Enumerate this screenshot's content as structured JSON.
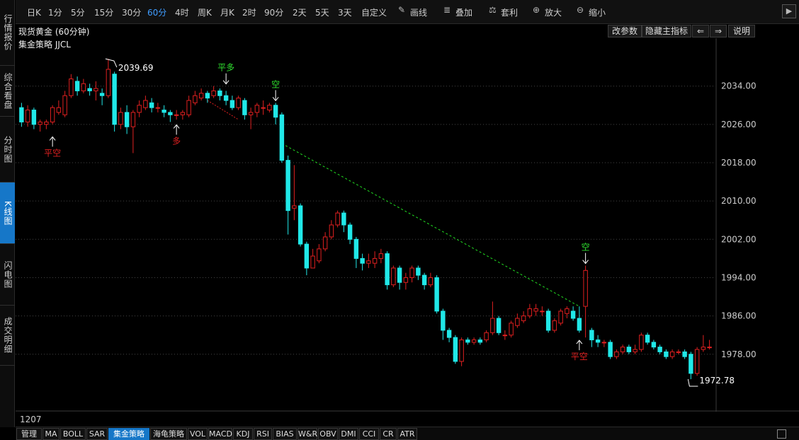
{
  "sidebar": {
    "tabs": [
      {
        "label": "行情报价",
        "active": false
      },
      {
        "label": "综合看盘",
        "active": false
      },
      {
        "label": "分时图",
        "active": false
      },
      {
        "label": "K线图",
        "active": true
      },
      {
        "label": "闪电图",
        "active": false
      },
      {
        "label": "成交明细",
        "active": false
      }
    ]
  },
  "toolbar": {
    "periods": [
      {
        "label": "日K",
        "active": false
      },
      {
        "label": "1分",
        "active": false
      },
      {
        "label": "5分",
        "active": false
      },
      {
        "label": "15分",
        "active": false
      },
      {
        "label": "30分",
        "active": false
      },
      {
        "label": "60分",
        "active": true
      },
      {
        "label": "4时",
        "active": false
      },
      {
        "label": "周K",
        "active": false
      },
      {
        "label": "月K",
        "active": false
      },
      {
        "label": "2时",
        "active": false
      },
      {
        "label": "90分",
        "active": false
      },
      {
        "label": "2天",
        "active": false
      },
      {
        "label": "5天",
        "active": false
      },
      {
        "label": "3天",
        "active": false
      },
      {
        "label": "自定义",
        "active": false
      }
    ],
    "tools": [
      {
        "label": "画线",
        "icon": "pencil-icon"
      },
      {
        "label": "叠加",
        "icon": "stack-icon"
      },
      {
        "label": "套利",
        "icon": "arbitrage-icon"
      },
      {
        "label": "放大",
        "icon": "zoom-in-icon"
      },
      {
        "label": "缩小",
        "icon": "zoom-out-icon"
      }
    ],
    "scroll_right": "▶"
  },
  "header": {
    "title": "现货黄金 (60分钟)",
    "strategy": "集金策略 JJCL",
    "buttons": {
      "change_params": "改参数",
      "hide_main": "隐藏主指标",
      "left": "⇐",
      "right": "⇒",
      "help": "说明"
    }
  },
  "bottom": {
    "value": "1207"
  },
  "indicators": [
    {
      "label": "管理",
      "active": false
    },
    {
      "label": "MA",
      "active": false
    },
    {
      "label": "BOLL",
      "active": false
    },
    {
      "label": "SAR",
      "active": false
    },
    {
      "label": "集金策略",
      "active": true
    },
    {
      "label": "海龟策略",
      "active": false
    },
    {
      "label": "VOL",
      "active": false
    },
    {
      "label": "MACD",
      "active": false
    },
    {
      "label": "KDJ",
      "active": false
    },
    {
      "label": "RSI",
      "active": false
    },
    {
      "label": "BIAS",
      "active": false
    },
    {
      "label": "W&R",
      "active": false
    },
    {
      "label": "OBV",
      "active": false
    },
    {
      "label": "DMI",
      "active": false
    },
    {
      "label": "CCI",
      "active": false
    },
    {
      "label": "CR",
      "active": false
    },
    {
      "label": "ATR",
      "active": false
    }
  ],
  "colors": {
    "up": "#e02020",
    "down": "#20e8e8",
    "signal_green": "#30e030",
    "signal_red": "#e02020",
    "trend_line": "#22dd22",
    "active_tab": "#1677c8"
  },
  "chart_data": {
    "type": "candlestick",
    "y_range": [
      1966,
      2044
    ],
    "y_ticks": [
      "2034.00",
      "2026.00",
      "2018.00",
      "2010.00",
      "2002.00",
      "1994.00",
      "1986.00",
      "1978.00"
    ],
    "high_label": "2039.69",
    "low_label": "1972.78",
    "candles": [
      [
        2029.5,
        2026.5,
        2030.5,
        2025.5
      ],
      [
        2026.5,
        2029,
        2030,
        2025.5
      ],
      [
        2029,
        2026,
        2029.5,
        2025
      ],
      [
        2026,
        2026.5,
        2027,
        2024.5
      ],
      [
        2026,
        2026.5,
        2027,
        2025
      ],
      [
        2026.5,
        2029.5,
        2030,
        2026
      ],
      [
        2028.5,
        2029.5,
        2031,
        2028
      ],
      [
        2028,
        2032,
        2033,
        2027.5
      ],
      [
        2032,
        2035.5,
        2036.5,
        2031.5
      ],
      [
        2035,
        2033,
        2036,
        2032
      ],
      [
        2033,
        2034.5,
        2035.5,
        2032.5
      ],
      [
        2033.5,
        2033,
        2034.5,
        2032
      ],
      [
        2033,
        2033.5,
        2035,
        2031
      ],
      [
        2032.5,
        2032,
        2033.5,
        2030
      ],
      [
        2032,
        2037.5,
        2039.7,
        2031.5
      ],
      [
        2036.5,
        2026,
        2037,
        2024.5
      ],
      [
        2026,
        2028.5,
        2029.5,
        2025
      ],
      [
        2028.5,
        2025.5,
        2030,
        2024
      ],
      [
        2025.5,
        2028.5,
        2029,
        2020
      ],
      [
        2028.5,
        2030,
        2031,
        2027.5
      ],
      [
        2029.5,
        2031,
        2032,
        2029
      ],
      [
        2030.5,
        2029.5,
        2031.5,
        2028.5
      ],
      [
        2029.5,
        2029.5,
        2030.5,
        2028.5
      ],
      [
        2029,
        2028.5,
        2030,
        2027.5
      ],
      [
        2028.5,
        2028,
        2029,
        2026.5
      ],
      [
        2028,
        2028,
        2029,
        2027
      ],
      [
        2028,
        2028.5,
        2029,
        2027
      ],
      [
        2028,
        2031,
        2032,
        2027.5
      ],
      [
        2030.5,
        2032,
        2033,
        2030
      ],
      [
        2031.5,
        2032.5,
        2033.5,
        2031
      ],
      [
        2032.5,
        2031.5,
        2033,
        2030.5
      ],
      [
        2032,
        2033,
        2034,
        2031.5
      ],
      [
        2033,
        2032,
        2033.5,
        2031
      ],
      [
        2032,
        2031,
        2033,
        2030
      ],
      [
        2031,
        2029.5,
        2032,
        2029
      ],
      [
        2029.5,
        2031.5,
        2032,
        2029
      ],
      [
        2031,
        2028,
        2031.5,
        2027
      ],
      [
        2028,
        2028.5,
        2029.5,
        2025
      ],
      [
        2028.5,
        2030,
        2030.5,
        2027.5
      ],
      [
        2029.5,
        2029.5,
        2031,
        2028
      ],
      [
        2029,
        2030,
        2030.5,
        2028.5
      ],
      [
        2030,
        2027.5,
        2030.5,
        2026
      ],
      [
        2028,
        2018.5,
        2028.5,
        2018
      ],
      [
        2018.5,
        2008,
        2019.5,
        2003
      ],
      [
        2008.5,
        2009,
        2017.5,
        2006
      ],
      [
        2009,
        2001,
        2009.5,
        2000.5
      ],
      [
        2001,
        1996,
        2001.5,
        1994.5
      ],
      [
        1996,
        1998.5,
        2000,
        1996
      ],
      [
        1997.5,
        2000,
        2001,
        1997
      ],
      [
        2000,
        2002.5,
        2003.5,
        1999.5
      ],
      [
        2002.5,
        2005,
        2006,
        2002
      ],
      [
        2005,
        2007.5,
        2008,
        2004.5
      ],
      [
        2007.5,
        2005,
        2008,
        2003.5
      ],
      [
        2005,
        2002,
        2005.5,
        2001
      ],
      [
        2002,
        1998,
        2002.5,
        1996
      ],
      [
        1998,
        1997,
        1999,
        1995.5
      ],
      [
        1997,
        1997.5,
        1999,
        1996
      ],
      [
        1997,
        1998,
        1999.5,
        1996
      ],
      [
        1998,
        1999,
        2000,
        1997
      ],
      [
        1999,
        1992.5,
        1999.5,
        1991.5
      ],
      [
        1992.5,
        1996,
        1996.5,
        1992
      ],
      [
        1996,
        1993,
        1996.5,
        1991.5
      ],
      [
        1993,
        1994,
        1995,
        1991.5
      ],
      [
        1994,
        1996,
        1996.5,
        1993
      ],
      [
        1996,
        1994.5,
        1996.5,
        1993.5
      ],
      [
        1994.5,
        1992.5,
        1995,
        1991.5
      ],
      [
        1992.5,
        1994,
        1995,
        1992
      ],
      [
        1994,
        1987,
        1994.5,
        1986.5
      ],
      [
        1987,
        1983,
        1987.5,
        1981
      ],
      [
        1983,
        1981.5,
        1983.5,
        1980.5
      ],
      [
        1981.5,
        1976.5,
        1982,
        1976
      ],
      [
        1976.5,
        1981,
        1981.5,
        1975.5
      ],
      [
        1981,
        1980.5,
        1981.5,
        1980
      ],
      [
        1980.5,
        1981,
        1981.5,
        1980
      ],
      [
        1981,
        1980.5,
        1981.5,
        1980
      ],
      [
        1981,
        1982.5,
        1983,
        1980.5
      ],
      [
        1982.5,
        1985.5,
        1989,
        1982
      ],
      [
        1985.5,
        1982.5,
        1986,
        1982
      ],
      [
        1982,
        1982,
        1983,
        1981
      ],
      [
        1982,
        1984.5,
        1985,
        1981.5
      ],
      [
        1984,
        1985.5,
        1986.5,
        1983.5
      ],
      [
        1985,
        1986,
        1987,
        1984.5
      ],
      [
        1986,
        1987.5,
        1988.5,
        1985.5
      ],
      [
        1987,
        1987.5,
        1988.5,
        1986
      ],
      [
        1987,
        1987,
        1988,
        1986
      ],
      [
        1987,
        1983,
        1987.5,
        1982.5
      ],
      [
        1983,
        1985,
        1985.5,
        1982.5
      ],
      [
        1984.5,
        1987,
        1987.5,
        1984
      ],
      [
        1986.5,
        1987.5,
        1988,
        1985.5
      ],
      [
        1987,
        1985.5,
        1988,
        1985
      ],
      [
        1985.5,
        1983,
        1988,
        1982.5
      ],
      [
        1988,
        1995.5,
        1996.5,
        1981.5
      ],
      [
        1983,
        1981,
        1983.5,
        1979.5
      ],
      [
        1981,
        1980.5,
        1982,
        1979.5
      ],
      [
        1980.5,
        1980.5,
        1981,
        1979.5
      ],
      [
        1980.5,
        1977.5,
        1981,
        1977
      ],
      [
        1977.5,
        1978.5,
        1979,
        1977
      ],
      [
        1978.5,
        1979.5,
        1980,
        1978
      ],
      [
        1979.5,
        1978.5,
        1980,
        1978
      ],
      [
        1978.5,
        1979,
        1980,
        1978
      ],
      [
        1979,
        1982,
        1982.5,
        1978.5
      ],
      [
        1982,
        1980.5,
        1982.5,
        1980
      ],
      [
        1980.5,
        1979.5,
        1981,
        1979
      ],
      [
        1979.5,
        1978.5,
        1980,
        1978
      ],
      [
        1978.5,
        1977.5,
        1979,
        1977
      ],
      [
        1977.5,
        1978.5,
        1979,
        1977
      ],
      [
        1978.5,
        1978.5,
        1979,
        1978
      ],
      [
        1978.5,
        1977.5,
        1979,
        1977
      ],
      [
        1978,
        1974,
        1978.5,
        1972.8
      ],
      [
        1974,
        1979,
        1979.5,
        1973.5
      ],
      [
        1979,
        1979.5,
        1982,
        1978.5
      ],
      [
        1979.5,
        1979.5,
        1981,
        1979
      ]
    ],
    "signals": [
      {
        "index": 5,
        "label": "平空",
        "color": "red",
        "position": "below",
        "price": 2024
      },
      {
        "index": 25,
        "label": "多",
        "color": "red",
        "position": "below",
        "price": 2026.5
      },
      {
        "index": 33,
        "label": "平多",
        "color": "green",
        "position": "above",
        "price": 2034
      },
      {
        "index": 41,
        "label": "空",
        "color": "green",
        "position": "above",
        "price": 2030.5
      },
      {
        "index": 90,
        "label": "平空",
        "color": "red",
        "position": "below",
        "price": 1981.5
      },
      {
        "index": 91,
        "label": "空",
        "color": "green",
        "position": "above",
        "price": 1996.5
      }
    ],
    "trend_line": {
      "from": [
        42,
        2022
      ],
      "to": [
        90,
        1988
      ]
    },
    "stop_line": {
      "from": [
        30,
        2031
      ],
      "to": [
        35,
        2027
      ]
    }
  }
}
